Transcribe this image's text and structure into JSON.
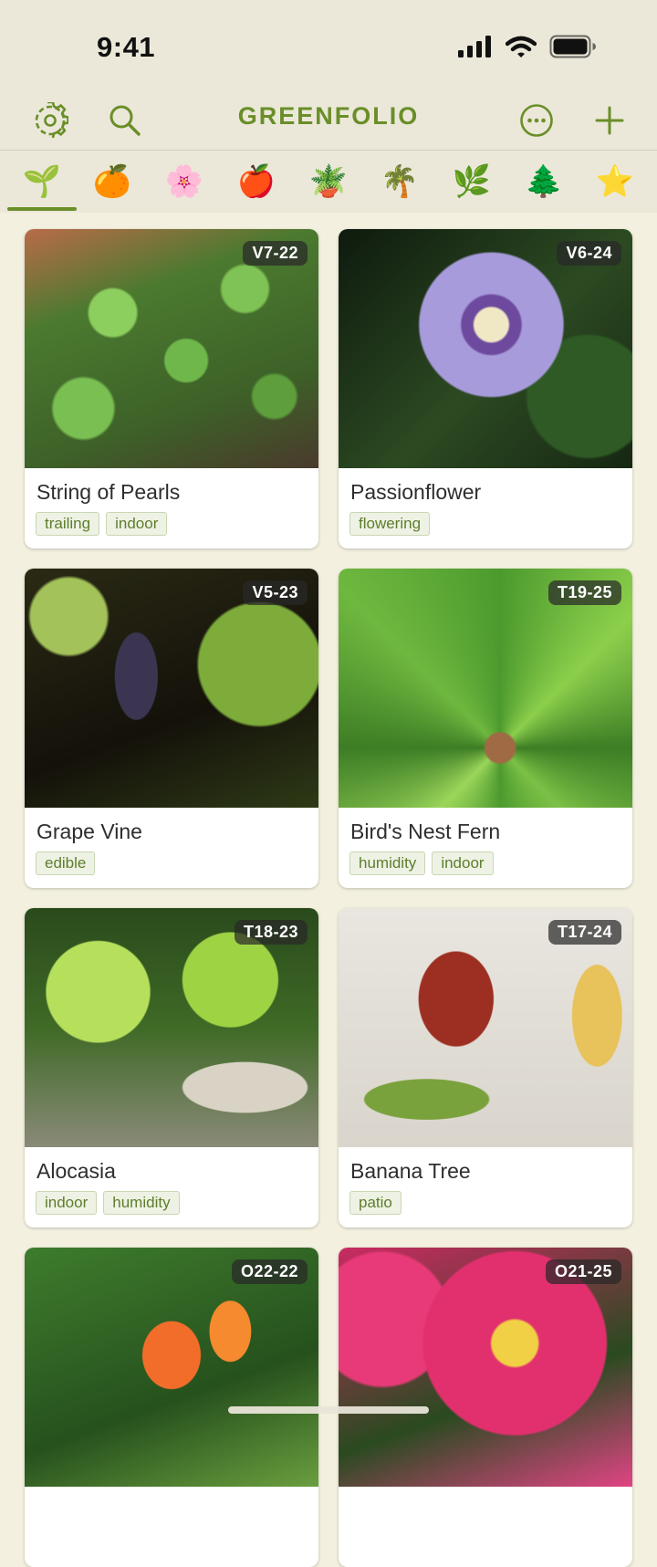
{
  "status": {
    "time": "9:41"
  },
  "nav": {
    "title": "GREENFOLIO"
  },
  "colors": {
    "accent": "#6a8e28",
    "background": "#f3f0df",
    "bar": "#ebe8d9"
  },
  "icons": {
    "left": [
      "gear-icon",
      "search-icon"
    ],
    "right": [
      "more-icon",
      "plus-icon"
    ]
  },
  "categories": [
    {
      "name": "seedling",
      "glyph": "🌱"
    },
    {
      "name": "orange",
      "glyph": "🍊"
    },
    {
      "name": "blossom",
      "glyph": "🌸"
    },
    {
      "name": "apple",
      "glyph": "🍎"
    },
    {
      "name": "potted-plant",
      "glyph": "🪴"
    },
    {
      "name": "palm-tree",
      "glyph": "🌴"
    },
    {
      "name": "herb",
      "glyph": "🌿"
    },
    {
      "name": "evergreen-tree",
      "glyph": "🌲"
    },
    {
      "name": "star",
      "glyph": "⭐"
    }
  ],
  "plants": [
    {
      "name": "String of Pearls",
      "zone": "V7-22",
      "tags": [
        "trailing",
        "indoor"
      ]
    },
    {
      "name": "Passionflower",
      "zone": "V6-24",
      "tags": [
        "flowering"
      ]
    },
    {
      "name": "Grape Vine",
      "zone": "V5-23",
      "tags": [
        "edible"
      ]
    },
    {
      "name": "Bird's Nest Fern",
      "zone": "T19-25",
      "tags": [
        "humidity",
        "indoor"
      ]
    },
    {
      "name": "Alocasia",
      "zone": "T18-23",
      "tags": [
        "indoor",
        "humidity"
      ]
    },
    {
      "name": "Banana Tree",
      "zone": "T17-24",
      "tags": [
        "patio"
      ]
    },
    {
      "name": "",
      "zone": "O22-22",
      "tags": []
    },
    {
      "name": "",
      "zone": "O21-25",
      "tags": []
    }
  ]
}
